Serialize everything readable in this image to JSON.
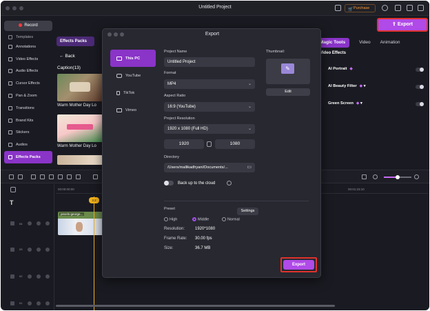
{
  "window": {
    "title": "Untitled Project",
    "purchase_label": "Purchase",
    "export_label": "Export"
  },
  "toolbar": {
    "record_label": "Record"
  },
  "sidebar": {
    "items": [
      {
        "label": "Templates"
      },
      {
        "label": "Annotations"
      },
      {
        "label": "Video Effects"
      },
      {
        "label": "Audio Effects"
      },
      {
        "label": "Cursor Effects"
      },
      {
        "label": "Pan & Zoom"
      },
      {
        "label": "Transitions"
      },
      {
        "label": "Brand Kits"
      },
      {
        "label": "Stickers"
      },
      {
        "label": "Audios"
      },
      {
        "label": "Effects Packs"
      }
    ]
  },
  "library": {
    "tab_label": "Effects Packs",
    "back_label": "Back",
    "caption_header": "Caption(13)",
    "thumbnails": [
      {
        "label": "Warm Mother Day Lo"
      },
      {
        "label": "Warm Mother Day Lo"
      }
    ]
  },
  "right_panel": {
    "tabs": [
      {
        "label": "Magic Tools"
      },
      {
        "label": "Video"
      },
      {
        "label": "Animation"
      }
    ],
    "section": "Video Effects",
    "tools": [
      {
        "label": "AI Portrait"
      },
      {
        "label": "AI Beauty Filter"
      },
      {
        "label": "Green Screen"
      }
    ]
  },
  "timeline": {
    "playhead_label": "3.2",
    "ruler_start": "00:00:00:00",
    "ruler_end": "00:01:23:10",
    "clip_label": "pexels-george...",
    "track_numbers": [
      "04",
      "03",
      "02",
      "01"
    ]
  },
  "export_dialog": {
    "title": "Export",
    "nav": [
      {
        "label": "This PC"
      },
      {
        "label": "YouTube"
      },
      {
        "label": "TikTok"
      },
      {
        "label": "Vimeo"
      }
    ],
    "project_name_label": "Project Name",
    "project_name": "Untitled Project",
    "format_label": "Format",
    "format": "MP4",
    "aspect_label": "Aspect Ratio",
    "aspect": "16:9 (YouTube)",
    "resolution_label": "Project Resolution",
    "resolution": "1920 x 1080 (Full HD)",
    "width": "1920",
    "height": "1080",
    "directory_label": "Directory",
    "directory": "/Users/mallikadhyani/Documents/...",
    "cloud_label": "Back up to the cloud",
    "thumbnail_label": "Thumbnail:",
    "edit_label": "Edit",
    "preset_label": "Preset",
    "settings_label": "Settings",
    "presets": [
      {
        "label": "High"
      },
      {
        "label": "Middle"
      },
      {
        "label": "Normal"
      }
    ],
    "info": {
      "resolution_key": "Resolution:",
      "resolution_val": "1920*1080",
      "framerate_key": "Frame Rate:",
      "framerate_val": "30.00 fps",
      "size_key": "Size:",
      "size_val": "36.7 MB"
    },
    "export_label": "Export"
  },
  "colors": {
    "accent": "#8a34c8",
    "export": "#b04ae8",
    "highlight": "#e0322c",
    "playhead": "#f3b21b"
  }
}
